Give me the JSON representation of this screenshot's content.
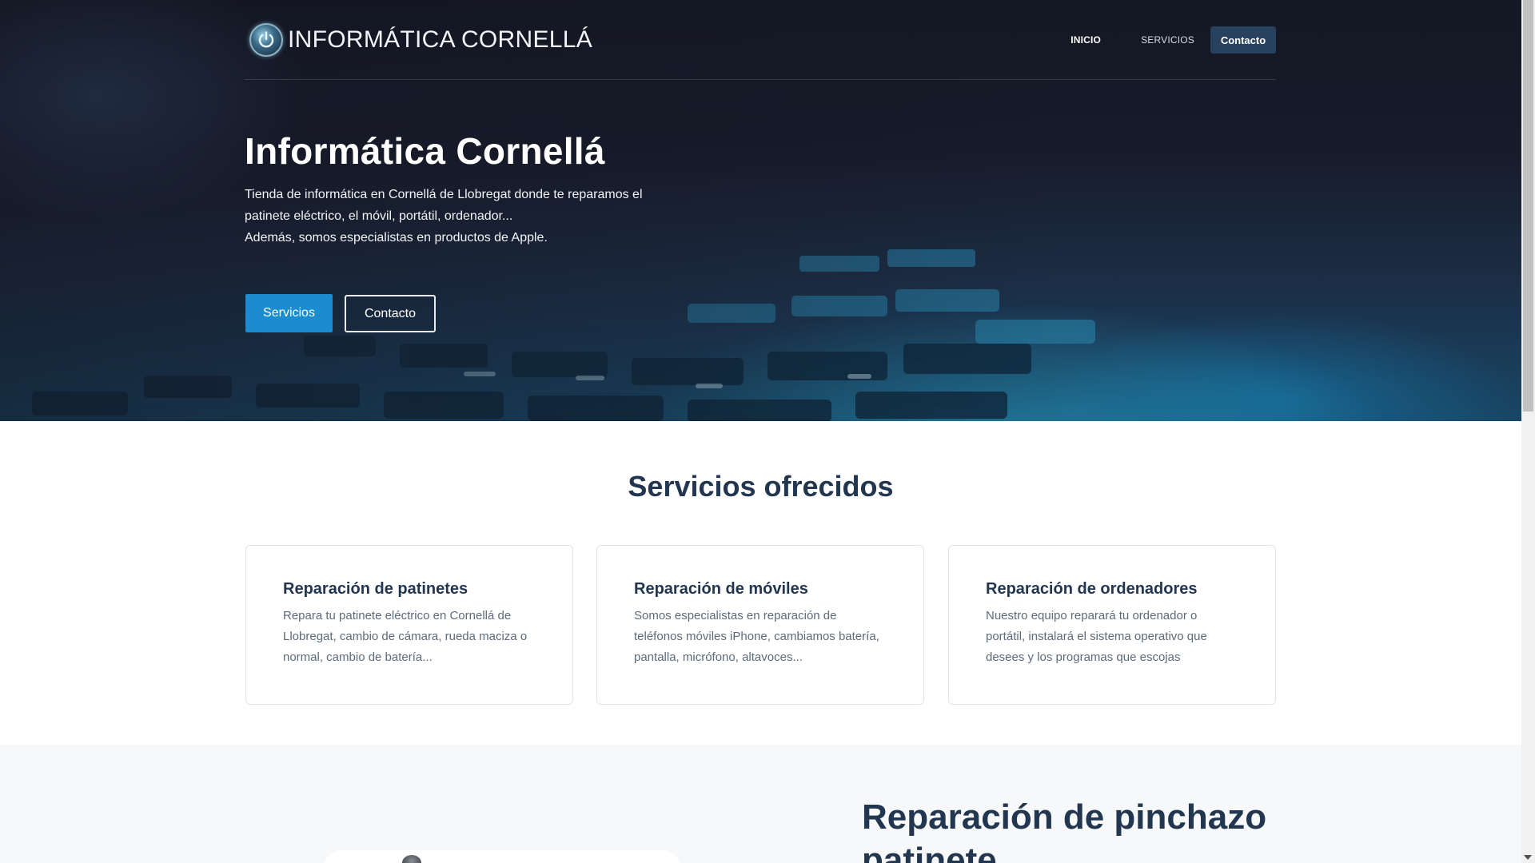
{
  "nav": {
    "logo_text": "INFORMÁTICA CORNELLÁ",
    "links": [
      {
        "label": "INICIO"
      },
      {
        "label": "SERVICIOS"
      }
    ],
    "contact_label": "Contacto"
  },
  "hero": {
    "title": "Informática Cornellá",
    "desc_line1": "Tienda de informática en Cornellá de Llobregat donde te reparamos el patinete eléctrico, el móvil, portátil, ordenador...",
    "desc_line2": "Además, somos especialistas en productos de Apple.",
    "primary_button": "Servicios",
    "secondary_button": "Contacto"
  },
  "services": {
    "title": "Servicios ofrecidos",
    "cards": [
      {
        "title": "Reparación de patinetes",
        "text": "Repara tu patinete eléctrico en Cornellá de Llobregat, cambio de cámara, rueda maciza o normal, cambio de batería..."
      },
      {
        "title": "Reparación de móviles",
        "text": "Somos especialistas en reparación de teléfonos móviles iPhone, cambiamos batería, pantalla, micrófono, altavoces..."
      },
      {
        "title": "Reparación de ordenadores",
        "text": "Nuestro equipo reparará tu ordenador o portátil, instalará el sistema operativo que desees y los programas que escojas"
      }
    ]
  },
  "lower": {
    "title": "Reparación de pinchazo patinete"
  },
  "colors": {
    "accent": "#1a8ccf",
    "navy": "#22364f",
    "nav_button": "#27415f"
  }
}
